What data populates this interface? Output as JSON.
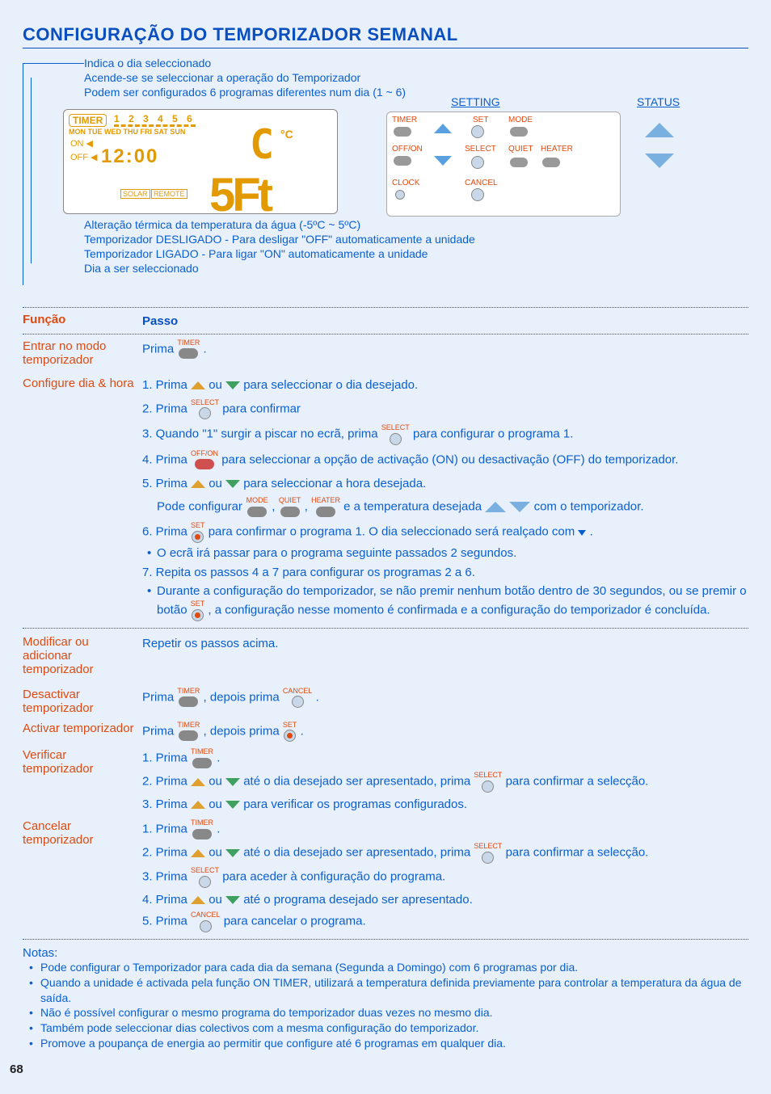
{
  "page_title": "CONFIGURAÇÃO DO TEMPORIZADOR SEMANAL",
  "page_number": "68",
  "callouts": {
    "c1": "Indica o dia seleccionado",
    "c2": "Acende-se se seleccionar a operação do Temporizador",
    "c3": "Podem ser configurados 6 programas diferentes num dia (1 ~ 6)",
    "c4": "Alteração térmica da temperatura da água (-5ºC ~ 5ºC)",
    "c5": "Temporizador DESLIGADO - Para desligar \"OFF\" automaticamente a unidade",
    "c6": "Temporizador LIGADO - Para ligar \"ON\" automaticamente a unidade",
    "c7": "Dia a ser seleccionado",
    "setting": "SETTING",
    "status": "STATUS"
  },
  "lcd": {
    "timer_box": "TIMER",
    "nums": "1 2 3 4 5 6",
    "days": "MON TUE WED THU FRI SAT SUN",
    "on": "ON ◀",
    "off": "OFF ◀",
    "solar": "SOLAR",
    "remote": "REMOTE",
    "bigc": "C",
    "unit": "°C",
    "clock": "12:00",
    "setword": "5Ft"
  },
  "ctrl": {
    "timer": "TIMER",
    "offon": "OFF/ON",
    "clock": "CLOCK",
    "set": "SET",
    "select": "SELECT",
    "cancel": "CANCEL",
    "mode": "MODE",
    "quiet": "QUIET",
    "heater": "HEATER"
  },
  "headers": {
    "funcao": "Função",
    "passo": "Passo"
  },
  "sections": {
    "entrar": {
      "title": "Entrar no modo temporizador",
      "p1a": "Prima ",
      "p1b": "."
    },
    "configure": {
      "title": "Configure dia & hora",
      "s1a": "1. Prima ",
      "s1b": " ou ",
      "s1c": " para seleccionar o dia desejado.",
      "s2a": "2. Prima ",
      "s2b": " para confirmar",
      "s3a": "3. Quando \"1\" surgir a piscar no ecrã, prima ",
      "s3b": " para configurar o programa 1.",
      "s4a": "4. Prima ",
      "s4b": " para seleccionar a opção de activação (ON) ou desactivação (OFF) do temporizador.",
      "s5a": "5. Prima ",
      "s5b": " ou ",
      "s5c": " para seleccionar a hora desejada.",
      "s5d": "Pode configurar ",
      "s5e": ", ",
      "s5f": ", ",
      "s5g": " e a temperatura desejada ",
      "s5h": " com o temporizador.",
      "s6a": "6. Prima ",
      "s6b": " para confirmar o programa 1. O dia seleccionado será realçado com ",
      "s6c": " .",
      "s6bul": "O ecrã irá passar para o programa seguinte passados 2 segundos.",
      "s7": "7. Repita os passos 4 a 7 para configurar os programas 2 a 6.",
      "s7bul_a": "Durante a configuração do temporizador, se não premir nenhum botão dentro de 30 segundos, ou se premir o botão ",
      "s7bul_b": " , a configuração nesse momento é confirmada e a configuração do temporizador é concluída."
    },
    "modificar": {
      "title": "Modificar ou adicionar temporizador",
      "p": "Repetir os passos acima."
    },
    "desactivar": {
      "title": "Desactivar temporizador",
      "p1": "Prima ",
      "p2": ", depois prima ",
      "p3": " ."
    },
    "activar": {
      "title": "Activar temporizador",
      "p1": "Prima ",
      "p2": ", depois prima ",
      "p3": "."
    },
    "verificar": {
      "title": "Verificar temporizador",
      "s1a": "1. Prima ",
      "s1b": ".",
      "s2a": "2. Prima ",
      "s2b": " ou ",
      "s2c": " até o dia desejado ser apresentado, prima ",
      "s2d": " para confirmar a selecção.",
      "s3a": "3. Prima ",
      "s3b": " ou ",
      "s3c": " para verificar os programas configurados."
    },
    "cancelar": {
      "title": "Cancelar temporizador",
      "s1a": "1. Prima ",
      "s1b": ".",
      "s2a": "2. Prima ",
      "s2b": " ou ",
      "s2c": " até o dia desejado ser apresentado, prima ",
      "s2d": " para confirmar a selecção.",
      "s3a": "3. Prima ",
      "s3b": " para aceder à configuração do programa.",
      "s4a": "4. Prima ",
      "s4b": " ou ",
      "s4c": " até o programa desejado ser apresentado.",
      "s5a": "5. Prima ",
      "s5b": " para cancelar o programa."
    }
  },
  "icon_caps": {
    "timer": "TIMER",
    "select": "SELECT",
    "offon": "OFF/ON",
    "set": "SET",
    "cancel": "CANCEL",
    "mode": "MODE",
    "quiet": "QUIET",
    "heater": "HEATER"
  },
  "notes": {
    "title": "Notas:",
    "n1": "Pode configurar o Temporizador para cada dia da semana (Segunda a Domingo) com 6 programas por dia.",
    "n2": "Quando a unidade é activada pela função ON TIMER, utilizará a temperatura definida previamente para controlar a temperatura da água de saída.",
    "n3": "Não é possível configurar o mesmo programa do temporizador duas vezes no mesmo dia.",
    "n4": "Também pode seleccionar dias colectivos com a mesma configuração do temporizador.",
    "n5": "Promove a poupança de energia ao permitir que configure até 6 programas em qualquer dia."
  }
}
